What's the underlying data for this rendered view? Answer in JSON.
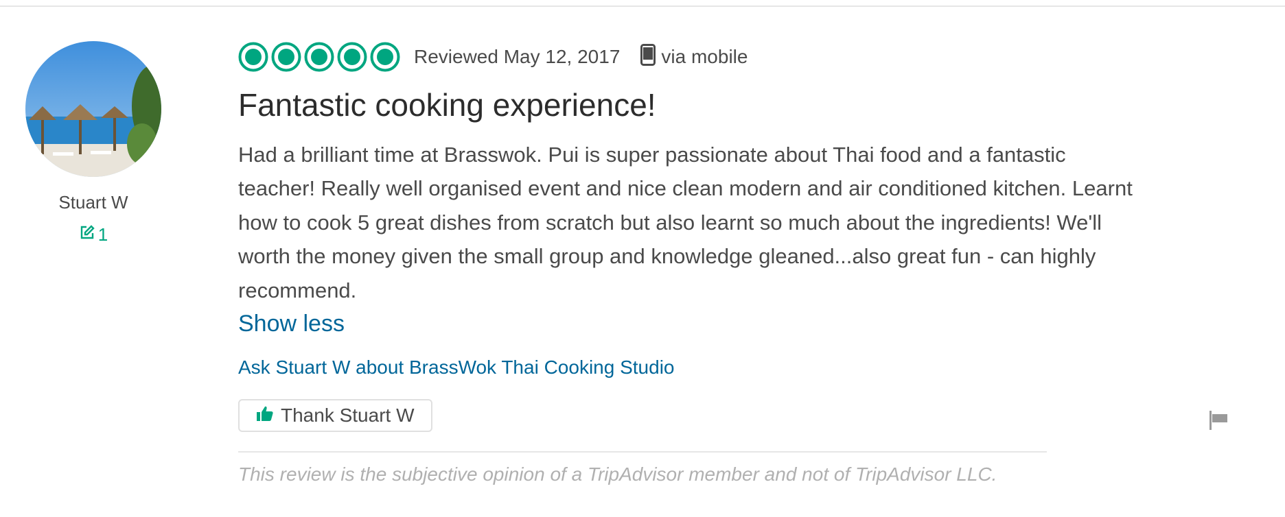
{
  "reviewer": {
    "name": "Stuart W",
    "contribution_count": "1"
  },
  "review": {
    "rating": 5,
    "rating_max": 5,
    "date": "Reviewed May 12, 2017",
    "via": "via mobile",
    "title": "Fantastic cooking experience!",
    "text": "Had a brilliant time at Brasswok. Pui is super passionate about Thai food and a fantastic teacher! Really well organised event and nice clean modern and air conditioned kitchen. Learnt how to cook 5 great dishes from scratch but also learnt so much about the ingredients! We'll worth the money given the small group and knowledge gleaned...also great fun - can highly recommend.",
    "show_less_label": "Show less",
    "ask_label": "Ask Stuart W about BrassWok Thai Cooking Studio",
    "thank_label": "Thank Stuart W",
    "disclaimer": "This review is the subjective opinion of a TripAdvisor member and not of TripAdvisor LLC."
  },
  "colors": {
    "accent_green": "#00a680",
    "link_blue": "#006699",
    "text_gray": "#4a4a4a",
    "muted_gray": "#b0b0b0"
  },
  "icons": {
    "rating": "rating-bubble-icon",
    "device": "mobile-phone-icon",
    "contribution": "pencil-edit-icon",
    "thank": "thumbs-up-icon",
    "report": "flag-icon"
  }
}
